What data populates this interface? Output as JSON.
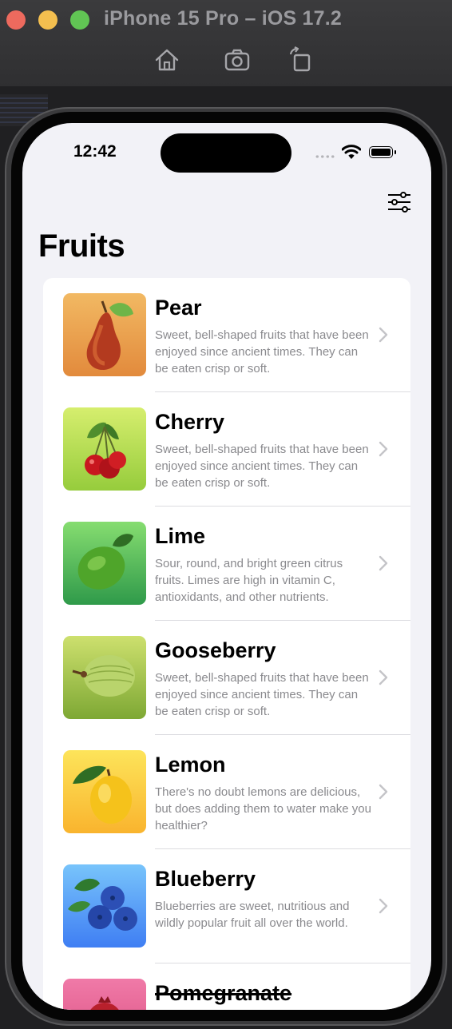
{
  "simulator": {
    "title": "iPhone 15 Pro – iOS 17.2",
    "tools": [
      "home-icon",
      "screenshot-icon",
      "rotate-icon"
    ]
  },
  "status_bar": {
    "time": "12:42"
  },
  "nav": {
    "title": "Fruits",
    "filter_icon": "slider-filter-icon"
  },
  "fruits": [
    {
      "name": "Pear",
      "description": "Sweet, bell-shaped fruits that have been enjoyed since ancient times. They can be eaten crisp or soft.",
      "bg_top": "#f2b963",
      "bg_bottom": "#e28a3c",
      "icon": "pear"
    },
    {
      "name": "Cherry",
      "description": "Sweet, bell-shaped fruits that have been enjoyed since ancient times. They can be eaten crisp or soft.",
      "bg_top": "#d6ee6e",
      "bg_bottom": "#96cc3c",
      "icon": "cherry"
    },
    {
      "name": "Lime",
      "description": "Sour, round, and bright green citrus fruits. Limes are high in vitamin C, antioxidants, and other nutrients.",
      "bg_top": "#86dd70",
      "bg_bottom": "#2f9a4a",
      "icon": "lime"
    },
    {
      "name": "Gooseberry",
      "description": "Sweet, bell-shaped fruits that have been enjoyed since ancient times. They can be eaten crisp or soft.",
      "bg_top": "#cde06e",
      "bg_bottom": "#7ea834",
      "icon": "gooseberry"
    },
    {
      "name": "Lemon",
      "description": "There's no doubt lemons are delicious, but does adding them to water make you healthier?",
      "bg_top": "#fde45a",
      "bg_bottom": "#f9b42e",
      "icon": "lemon"
    },
    {
      "name": "Blueberry",
      "description": "Blueberries are sweet, nutritious and wildly popular fruit all over the world.",
      "bg_top": "#78c4fb",
      "bg_bottom": "#3f7ef3",
      "icon": "blueberry"
    },
    {
      "name": "Pomegranate",
      "description": "",
      "bg_top": "#f07aa8",
      "bg_bottom": "#d94c7d",
      "icon": "pomegranate"
    }
  ]
}
